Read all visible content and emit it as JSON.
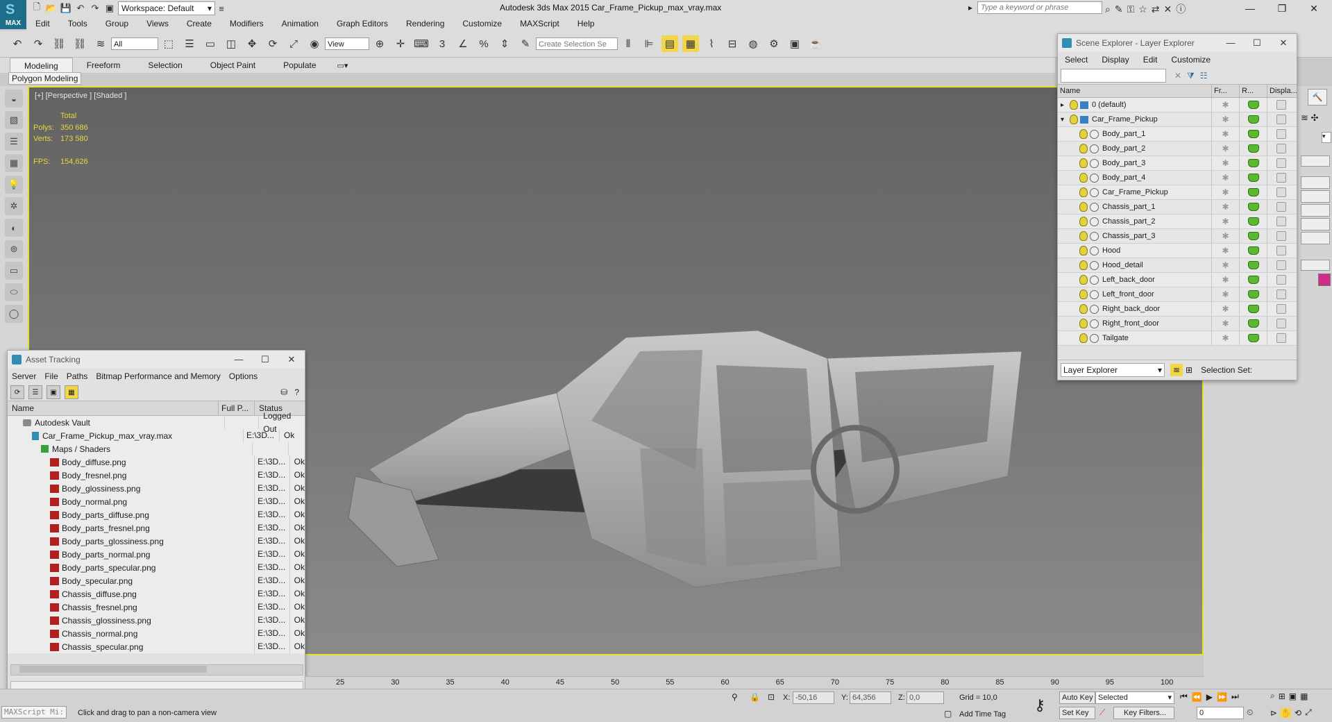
{
  "app": {
    "logo": "MAX",
    "title": "Autodesk 3ds Max  2015    Car_Frame_Pickup_max_vray.max",
    "workspace": "Workspace: Default",
    "search_placeholder": "Type a keyword or phrase"
  },
  "menu": [
    "Edit",
    "Tools",
    "Group",
    "Views",
    "Create",
    "Modifiers",
    "Animation",
    "Graph Editors",
    "Rendering",
    "Customize",
    "MAXScript",
    "Help"
  ],
  "toolbar": {
    "selection_filter": "All",
    "ref_coord": "View",
    "create_selection_set": "Create Selection Se"
  },
  "ribbon": {
    "tabs": [
      "Modeling",
      "Freeform",
      "Selection",
      "Object Paint",
      "Populate"
    ],
    "active_tab": "Modeling",
    "sub_tab": "Polygon Modeling"
  },
  "viewport": {
    "label": "[+] [Perspective ] [Shaded ]",
    "stats": {
      "total_label": "Total",
      "polys_label": "Polys:",
      "polys": "350 686",
      "verts_label": "Verts:",
      "verts": "173 580",
      "fps_label": "FPS:",
      "fps": "154,626"
    }
  },
  "scene_explorer": {
    "title": "Scene Explorer - Layer Explorer",
    "menu": [
      "Select",
      "Display",
      "Edit",
      "Customize"
    ],
    "columns": [
      "Name",
      "Fr...",
      "R...",
      "Displa..."
    ],
    "rows": [
      {
        "name": "0 (default)",
        "indent": 0,
        "expander": "▸",
        "layer": true
      },
      {
        "name": "Car_Frame_Pickup",
        "indent": 0,
        "expander": "▾",
        "layer": true
      },
      {
        "name": "Body_part_1",
        "indent": 1
      },
      {
        "name": "Body_part_2",
        "indent": 1
      },
      {
        "name": "Body_part_3",
        "indent": 1
      },
      {
        "name": "Body_part_4",
        "indent": 1
      },
      {
        "name": "Car_Frame_Pickup",
        "indent": 1
      },
      {
        "name": "Chassis_part_1",
        "indent": 1
      },
      {
        "name": "Chassis_part_2",
        "indent": 1
      },
      {
        "name": "Chassis_part_3",
        "indent": 1
      },
      {
        "name": "Hood",
        "indent": 1
      },
      {
        "name": "Hood_detail",
        "indent": 1
      },
      {
        "name": "Left_back_door",
        "indent": 1
      },
      {
        "name": "Left_front_door",
        "indent": 1
      },
      {
        "name": "Right_back_door",
        "indent": 1
      },
      {
        "name": "Right_front_door",
        "indent": 1
      },
      {
        "name": "Tailgate",
        "indent": 1
      }
    ],
    "explorer_dropdown": "Layer Explorer",
    "selection_set_label": "Selection Set:"
  },
  "asset_tracking": {
    "title": "Asset Tracking",
    "menu": [
      "Server",
      "File",
      "Paths",
      "Bitmap Performance and Memory",
      "Options"
    ],
    "columns": [
      "Name",
      "Full P...",
      "Status"
    ],
    "rows": [
      {
        "name": "Autodesk Vault",
        "path": "",
        "status": "Logged Out",
        "kind": "vault",
        "indent": 0
      },
      {
        "name": "Car_Frame_Pickup_max_vray.max",
        "path": "E:\\3D...",
        "status": "Ok",
        "kind": "max",
        "indent": 1
      },
      {
        "name": "Maps / Shaders",
        "path": "",
        "status": "",
        "kind": "maps",
        "indent": 2
      },
      {
        "name": "Body_diffuse.png",
        "path": "E:\\3D...",
        "status": "Ok",
        "kind": "png",
        "indent": 3
      },
      {
        "name": "Body_fresnel.png",
        "path": "E:\\3D...",
        "status": "Ok",
        "kind": "png",
        "indent": 3
      },
      {
        "name": "Body_glossiness.png",
        "path": "E:\\3D...",
        "status": "Ok",
        "kind": "png",
        "indent": 3
      },
      {
        "name": "Body_normal.png",
        "path": "E:\\3D...",
        "status": "Ok",
        "kind": "png",
        "indent": 3
      },
      {
        "name": "Body_parts_diffuse.png",
        "path": "E:\\3D...",
        "status": "Ok",
        "kind": "png",
        "indent": 3
      },
      {
        "name": "Body_parts_fresnel.png",
        "path": "E:\\3D...",
        "status": "Ok",
        "kind": "png",
        "indent": 3
      },
      {
        "name": "Body_parts_glossiness.png",
        "path": "E:\\3D...",
        "status": "Ok",
        "kind": "png",
        "indent": 3
      },
      {
        "name": "Body_parts_normal.png",
        "path": "E:\\3D...",
        "status": "Ok",
        "kind": "png",
        "indent": 3
      },
      {
        "name": "Body_parts_specular.png",
        "path": "E:\\3D...",
        "status": "Ok",
        "kind": "png",
        "indent": 3
      },
      {
        "name": "Body_specular.png",
        "path": "E:\\3D...",
        "status": "Ok",
        "kind": "png",
        "indent": 3
      },
      {
        "name": "Chassis_diffuse.png",
        "path": "E:\\3D...",
        "status": "Ok",
        "kind": "png",
        "indent": 3
      },
      {
        "name": "Chassis_fresnel.png",
        "path": "E:\\3D...",
        "status": "Ok",
        "kind": "png",
        "indent": 3
      },
      {
        "name": "Chassis_glossiness.png",
        "path": "E:\\3D...",
        "status": "Ok",
        "kind": "png",
        "indent": 3
      },
      {
        "name": "Chassis_normal.png",
        "path": "E:\\3D...",
        "status": "Ok",
        "kind": "png",
        "indent": 3
      },
      {
        "name": "Chassis_specular.png",
        "path": "E:\\3D...",
        "status": "Ok",
        "kind": "png",
        "indent": 3
      }
    ]
  },
  "timeline": {
    "ticks": [
      "25",
      "30",
      "35",
      "40",
      "45",
      "50",
      "55",
      "60",
      "65",
      "70",
      "75",
      "80",
      "85",
      "90",
      "95",
      "100"
    ]
  },
  "statusbar": {
    "maxscript": "MAXScript Mi:",
    "prompt": "Click and drag to pan a non-camera view",
    "x_label": "X:",
    "x_value": "-50,16",
    "y_label": "Y:",
    "y_value": "64,356",
    "z_label": "Z:",
    "z_value": "0,0",
    "grid": "Grid = 10,0",
    "add_time_tag": "Add Time Tag",
    "auto_key": "Auto Key",
    "set_key": "Set Key",
    "selected": "Selected",
    "key_filters": "Key Filters...",
    "frame": "0"
  }
}
